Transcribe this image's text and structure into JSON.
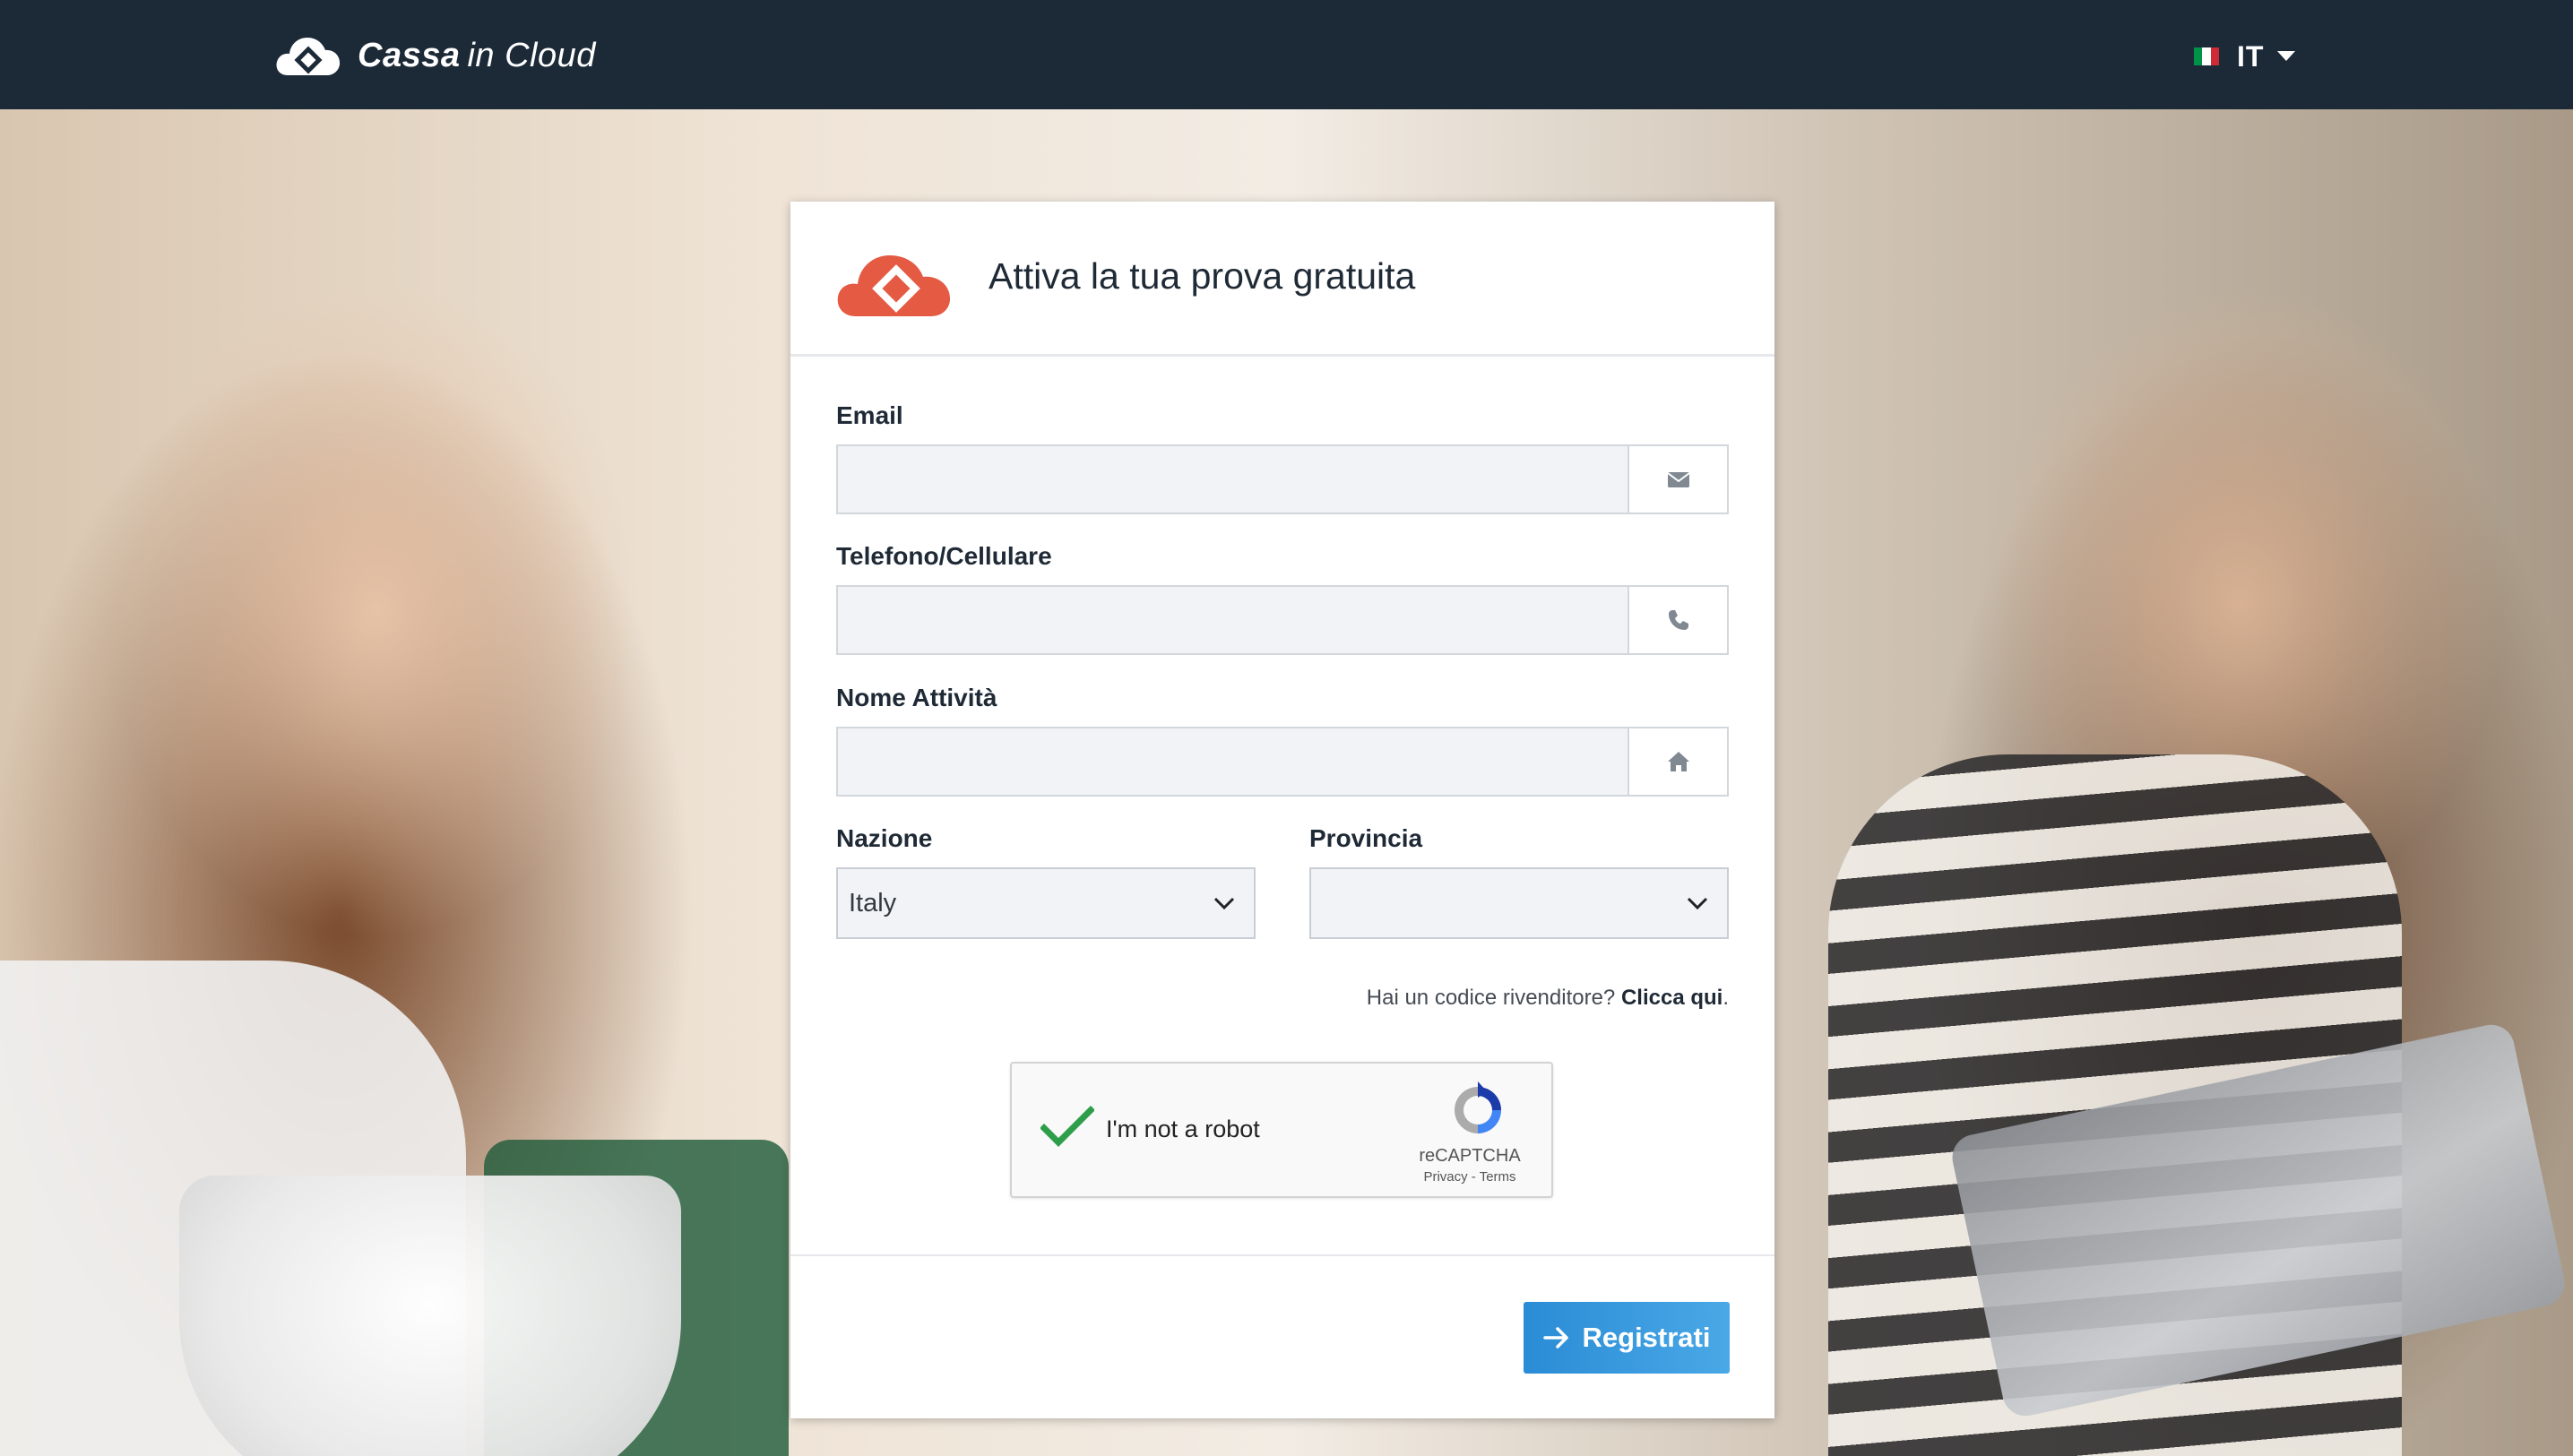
{
  "topbar": {
    "brand_primary": "Cassa",
    "brand_secondary": "in Cloud",
    "language_code": "IT",
    "flag_colors": [
      "#009246",
      "#ffffff",
      "#ce2b37"
    ]
  },
  "card": {
    "title": "Attiva la tua prova gratuita",
    "logo_color": "#e45a43",
    "fields": {
      "email": {
        "label": "Email",
        "value": "",
        "icon": "envelope-icon"
      },
      "phone": {
        "label": "Telefono/Cellulare",
        "value": "",
        "icon": "phone-icon"
      },
      "business": {
        "label": "Nome Attività",
        "value": "",
        "icon": "home-icon"
      }
    },
    "country": {
      "label": "Nazione",
      "selected": "Italy"
    },
    "province": {
      "label": "Provincia",
      "selected": ""
    },
    "reseller": {
      "question": "Hai un codice rivenditore?",
      "link": "Clicca qui",
      "suffix": "."
    },
    "captcha": {
      "label": "I'm not a robot",
      "checked": true,
      "brand": "reCAPTCHA",
      "privacy": "Privacy",
      "separator": " - ",
      "terms": "Terms"
    },
    "submit": {
      "label": "Registrati",
      "icon": "arrow-right-icon",
      "color": "#2f8fd8"
    }
  },
  "colors": {
    "topbar": "#1c2a38",
    "accent": "#e45a43",
    "input_bg": "#f1f3f6",
    "check": "#2e9e4a"
  }
}
